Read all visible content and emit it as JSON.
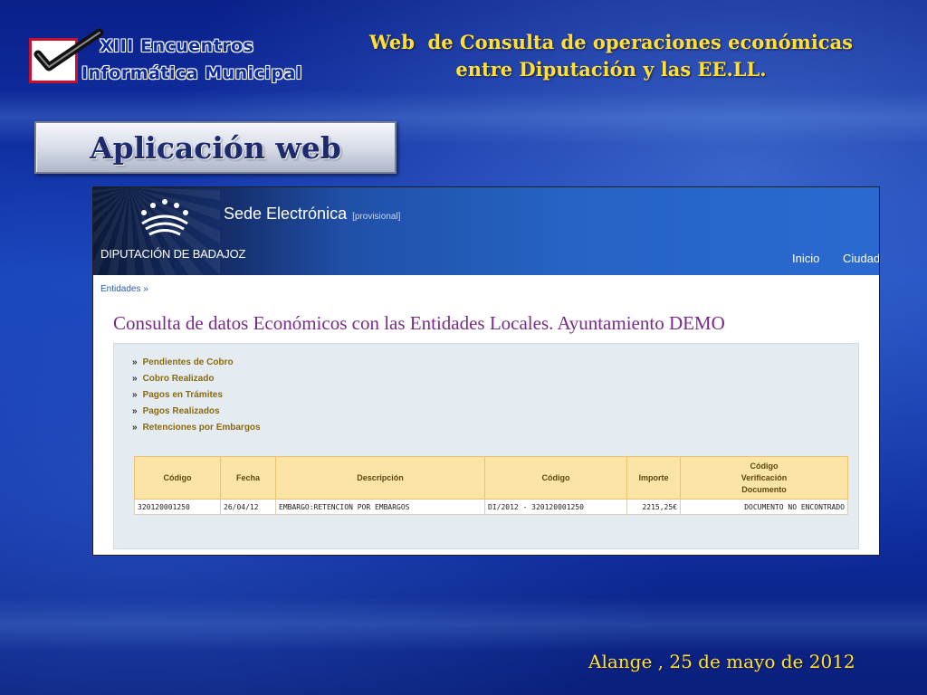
{
  "logo": {
    "line1": "XIII Encuentros",
    "line2": "Informática Municipal",
    "icon": "checkmark-icon"
  },
  "header": {
    "title_line1": "Web  de Consulta de operaciones económicas",
    "title_line2": "entre Diputación y las EE.LL."
  },
  "section": {
    "title": "Aplicación web"
  },
  "site": {
    "title": "Sede Electrónica",
    "tag": "[provisional]",
    "org": "DIPUTACIÓN DE BADAJOZ",
    "nav": [
      "Inicio",
      "Ciudada"
    ],
    "breadcrumb": "Entidades »",
    "page_title": "Consulta de datos Económicos con las Entidades Locales. Ayuntamiento DEMO",
    "menu": [
      "Pendientes de Cobro",
      "Cobro Realizado",
      "Pagos en Trámites",
      "Pagos Realizados",
      "Retenciones por Embargos"
    ],
    "menu_arrow": "»",
    "table": {
      "headers": [
        "Código",
        "Fecha",
        "Descripción",
        "Código",
        "Importe",
        "Código Verificación Documento"
      ],
      "header_last_lines": [
        "Código",
        "Verificación",
        "Documento"
      ],
      "rows": [
        [
          "320120001250",
          "26/04/12",
          "EMBARGO:RETENCION POR EMBARGOS",
          "DI/2012 - 320120001250",
          "2215,25€",
          "DOCUMENTO NO ENCONTRADO"
        ]
      ]
    }
  },
  "footer": {
    "text": "Alange , 25 de mayo de 2012"
  },
  "colors": {
    "accent_yellow": "#ffe033",
    "title_purple": "#7a2a8a",
    "table_header": "#fce3a6",
    "menu_text": "#8a6a10"
  }
}
